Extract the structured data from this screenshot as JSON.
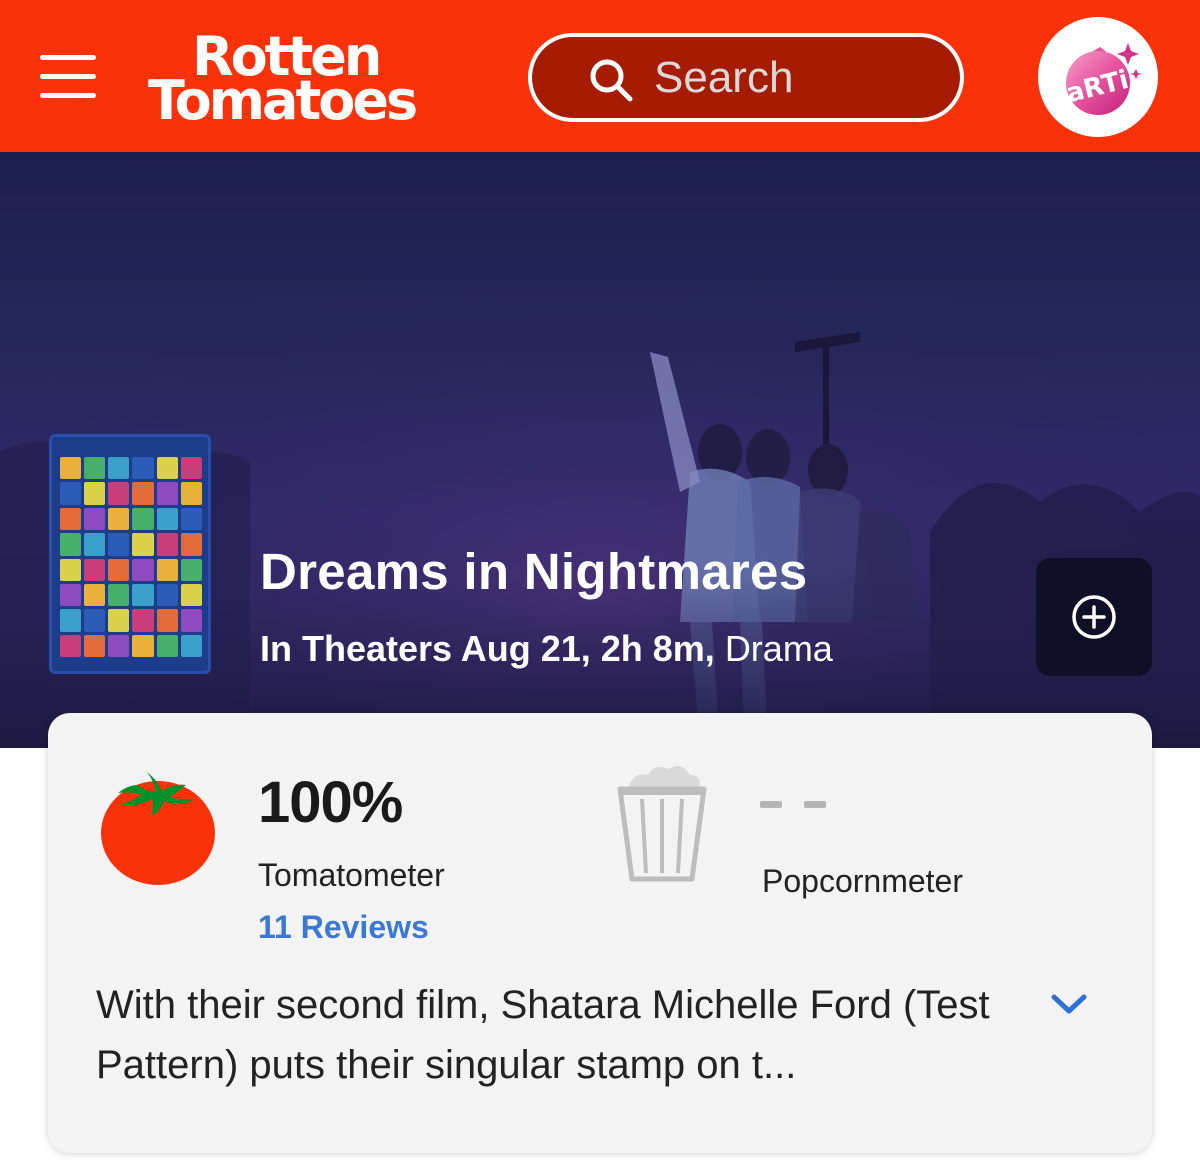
{
  "header": {
    "logo_line1": "Rotten",
    "logo_line2": "Tomatoes",
    "search_placeholder": "Search",
    "avatar_label": "aRTi",
    "brand_color": "#fa320a"
  },
  "movie": {
    "title": "Dreams in Nightmares",
    "meta_info": "In Theaters Aug 21, 2h 8m,",
    "genre": "Drama"
  },
  "scores": {
    "tomatometer_value": "100%",
    "tomatometer_label": "Tomatometer",
    "reviews_link": "11 Reviews",
    "popcornmeter_value": "- -",
    "popcornmeter_label": "Popcornmeter"
  },
  "consensus": {
    "text": "With their second film, Shatara Michelle Ford (Test Pattern) puts their singular stamp on t..."
  },
  "icons": {
    "menu": "hamburger-menu-icon",
    "search": "search-icon",
    "add": "plus-circle-icon",
    "expand": "chevron-down-icon",
    "tomato": "fresh-tomato-icon",
    "popcorn": "empty-popcorn-bucket-icon"
  }
}
